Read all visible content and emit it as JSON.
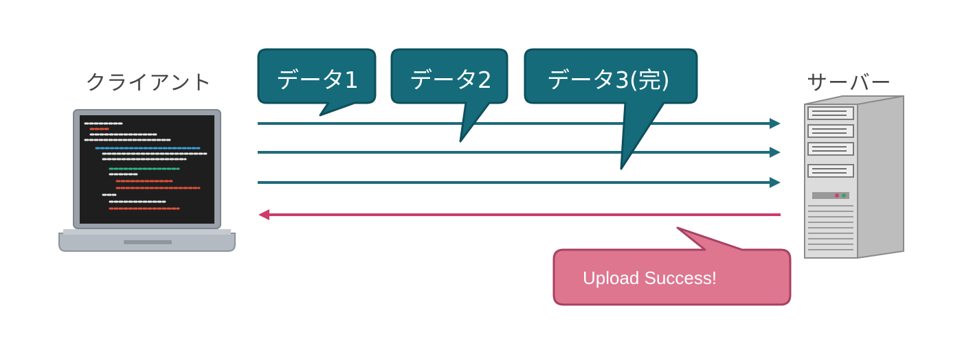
{
  "client": {
    "label": "クライアント"
  },
  "server": {
    "label": "サーバー"
  },
  "messages": [
    {
      "label": "データ1"
    },
    {
      "label": "データ2"
    },
    {
      "label": "データ3(完)"
    }
  ],
  "response": {
    "label": "Upload Success!"
  },
  "colors": {
    "request": "#1d6b7b",
    "response": "#cc3d6a",
    "bubble": "#156b7a",
    "bubble_stroke": "#0e4f5c",
    "success_bubble": "#de7690",
    "success_stroke": "#a84062"
  }
}
